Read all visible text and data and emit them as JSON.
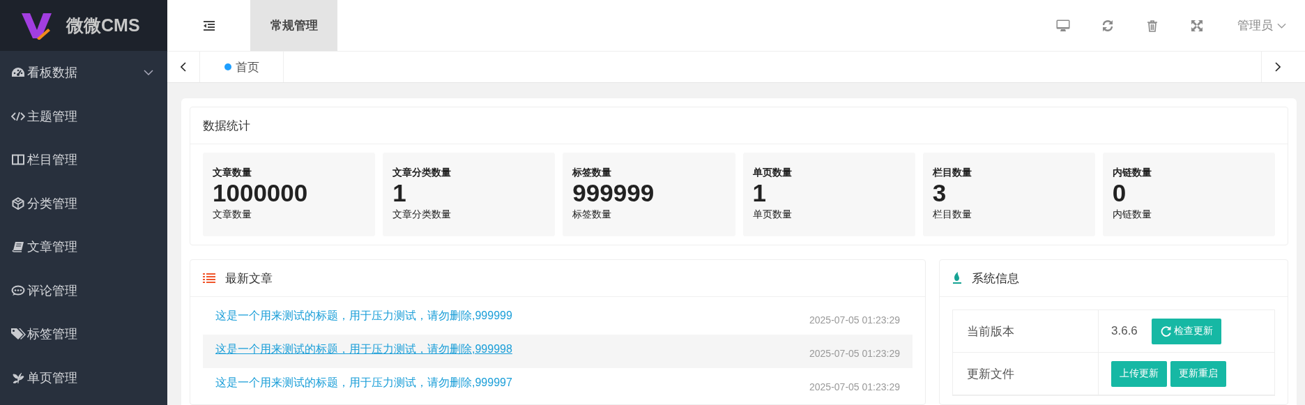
{
  "brand": {
    "name": "微微CMS"
  },
  "sidebar": {
    "items": [
      {
        "label": "看板数据",
        "expanded": false
      },
      {
        "label": "主题管理"
      },
      {
        "label": "栏目管理"
      },
      {
        "label": "分类管理"
      },
      {
        "label": "文章管理"
      },
      {
        "label": "评论管理"
      },
      {
        "label": "标签管理"
      },
      {
        "label": "单页管理"
      }
    ]
  },
  "header": {
    "top_tabs": [
      {
        "label": "常规管理",
        "selected": true
      }
    ],
    "user": "管理员"
  },
  "page_tabs": [
    {
      "label": "首页",
      "selected": true
    }
  ],
  "stats": {
    "title": "数据统计",
    "items": [
      {
        "label": "文章数量",
        "value": "1000000",
        "caption": "文章数量"
      },
      {
        "label": "文章分类数量",
        "value": "1",
        "caption": "文章分类数量"
      },
      {
        "label": "标签数量",
        "value": "999999",
        "caption": "标签数量"
      },
      {
        "label": "单页数量",
        "value": "1",
        "caption": "单页数量"
      },
      {
        "label": "栏目数量",
        "value": "3",
        "caption": "栏目数量"
      },
      {
        "label": "内链数量",
        "value": "0",
        "caption": "内链数量"
      }
    ]
  },
  "latest": {
    "title": "最新文章",
    "items": [
      {
        "title": "这是一个用来测试的标题，用于压力测试，请勿删除,999999",
        "time": "2025-07-05 01:23:29",
        "highlighted": false
      },
      {
        "title": "这是一个用来测试的标题，用于压力测试，请勿删除,999998",
        "time": "2025-07-05 01:23:29",
        "highlighted": true
      },
      {
        "title": "这是一个用来测试的标题，用于压力测试，请勿删除,999997",
        "time": "2025-07-05 01:23:29",
        "highlighted": false
      }
    ]
  },
  "system": {
    "title": "系统信息",
    "rows": [
      {
        "label": "当前版本",
        "value": "3.6.6",
        "buttons": [
          {
            "label": "检查更新"
          }
        ]
      },
      {
        "label": "更新文件",
        "buttons": [
          {
            "label": "上传更新"
          },
          {
            "label": "更新重启"
          }
        ]
      }
    ]
  }
}
